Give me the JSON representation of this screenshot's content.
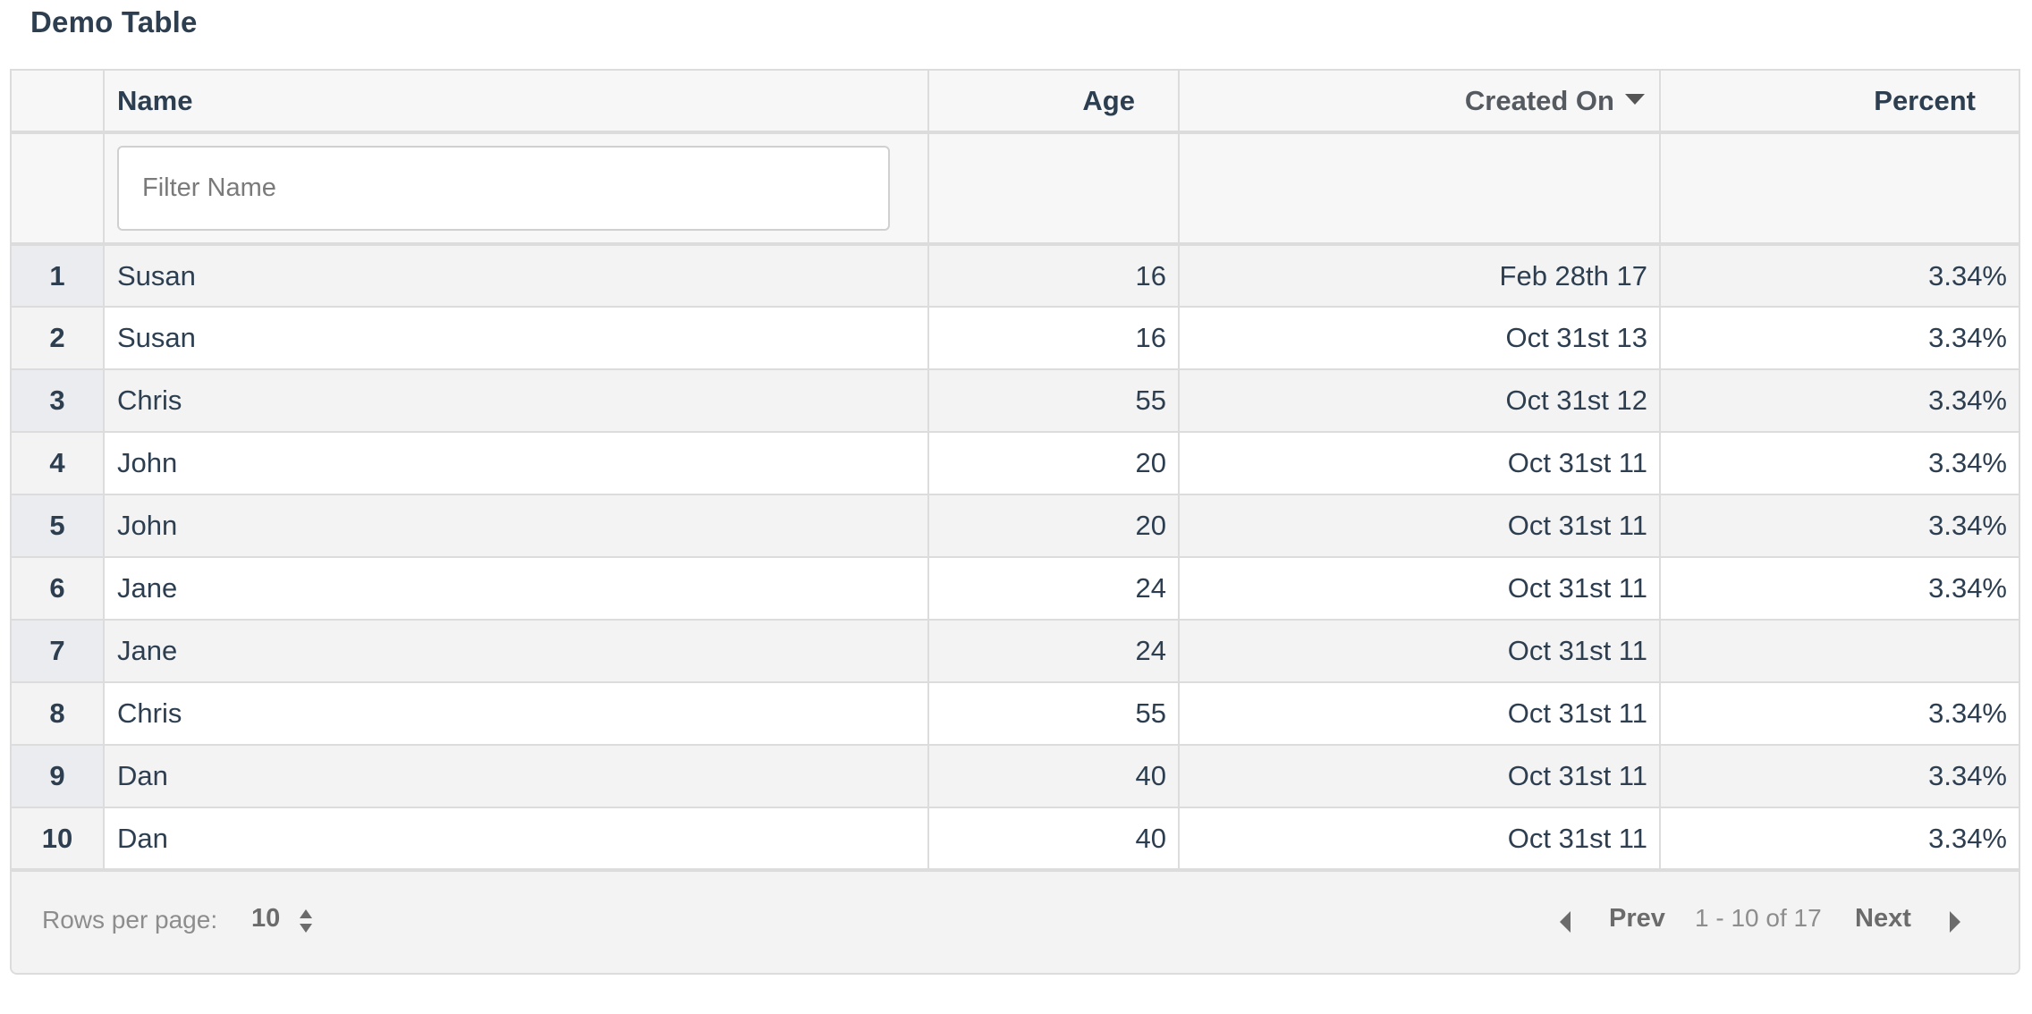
{
  "page": {
    "title": "Demo Table"
  },
  "table": {
    "columns": [
      {
        "key": "index",
        "label": ""
      },
      {
        "key": "name",
        "label": "Name"
      },
      {
        "key": "age",
        "label": "Age"
      },
      {
        "key": "created_on",
        "label": "Created On",
        "sorted": "descending"
      },
      {
        "key": "percent",
        "label": "Percent"
      }
    ],
    "filter": {
      "name_placeholder": "Filter Name",
      "name_value": ""
    },
    "rows": [
      {
        "index": "1",
        "name": "Susan",
        "age": "16",
        "created_on": "Feb 28th 17",
        "percent": "3.34%"
      },
      {
        "index": "2",
        "name": "Susan",
        "age": "16",
        "created_on": "Oct 31st 13",
        "percent": "3.34%"
      },
      {
        "index": "3",
        "name": "Chris",
        "age": "55",
        "created_on": "Oct 31st 12",
        "percent": "3.34%"
      },
      {
        "index": "4",
        "name": "John",
        "age": "20",
        "created_on": "Oct 31st 11",
        "percent": "3.34%"
      },
      {
        "index": "5",
        "name": "John",
        "age": "20",
        "created_on": "Oct 31st 11",
        "percent": "3.34%"
      },
      {
        "index": "6",
        "name": "Jane",
        "age": "24",
        "created_on": "Oct 31st 11",
        "percent": "3.34%"
      },
      {
        "index": "7",
        "name": "Jane",
        "age": "24",
        "created_on": "Oct 31st 11",
        "percent": ""
      },
      {
        "index": "8",
        "name": "Chris",
        "age": "55",
        "created_on": "Oct 31st 11",
        "percent": "3.34%"
      },
      {
        "index": "9",
        "name": "Dan",
        "age": "40",
        "created_on": "Oct 31st 11",
        "percent": "3.34%"
      },
      {
        "index": "10",
        "name": "Dan",
        "age": "40",
        "created_on": "Oct 31st 11",
        "percent": "3.34%"
      }
    ]
  },
  "footer": {
    "rows_per_page_label": "Rows per page:",
    "rows_per_page_value": "10",
    "prev_label": "Prev",
    "page_info": "1 - 10 of 17",
    "next_label": "Next"
  },
  "icons": {
    "sort": "caret-down-icon",
    "rows_spinner": "up-down-spinner-icon",
    "prev": "caret-left-icon",
    "next": "caret-right-icon"
  }
}
